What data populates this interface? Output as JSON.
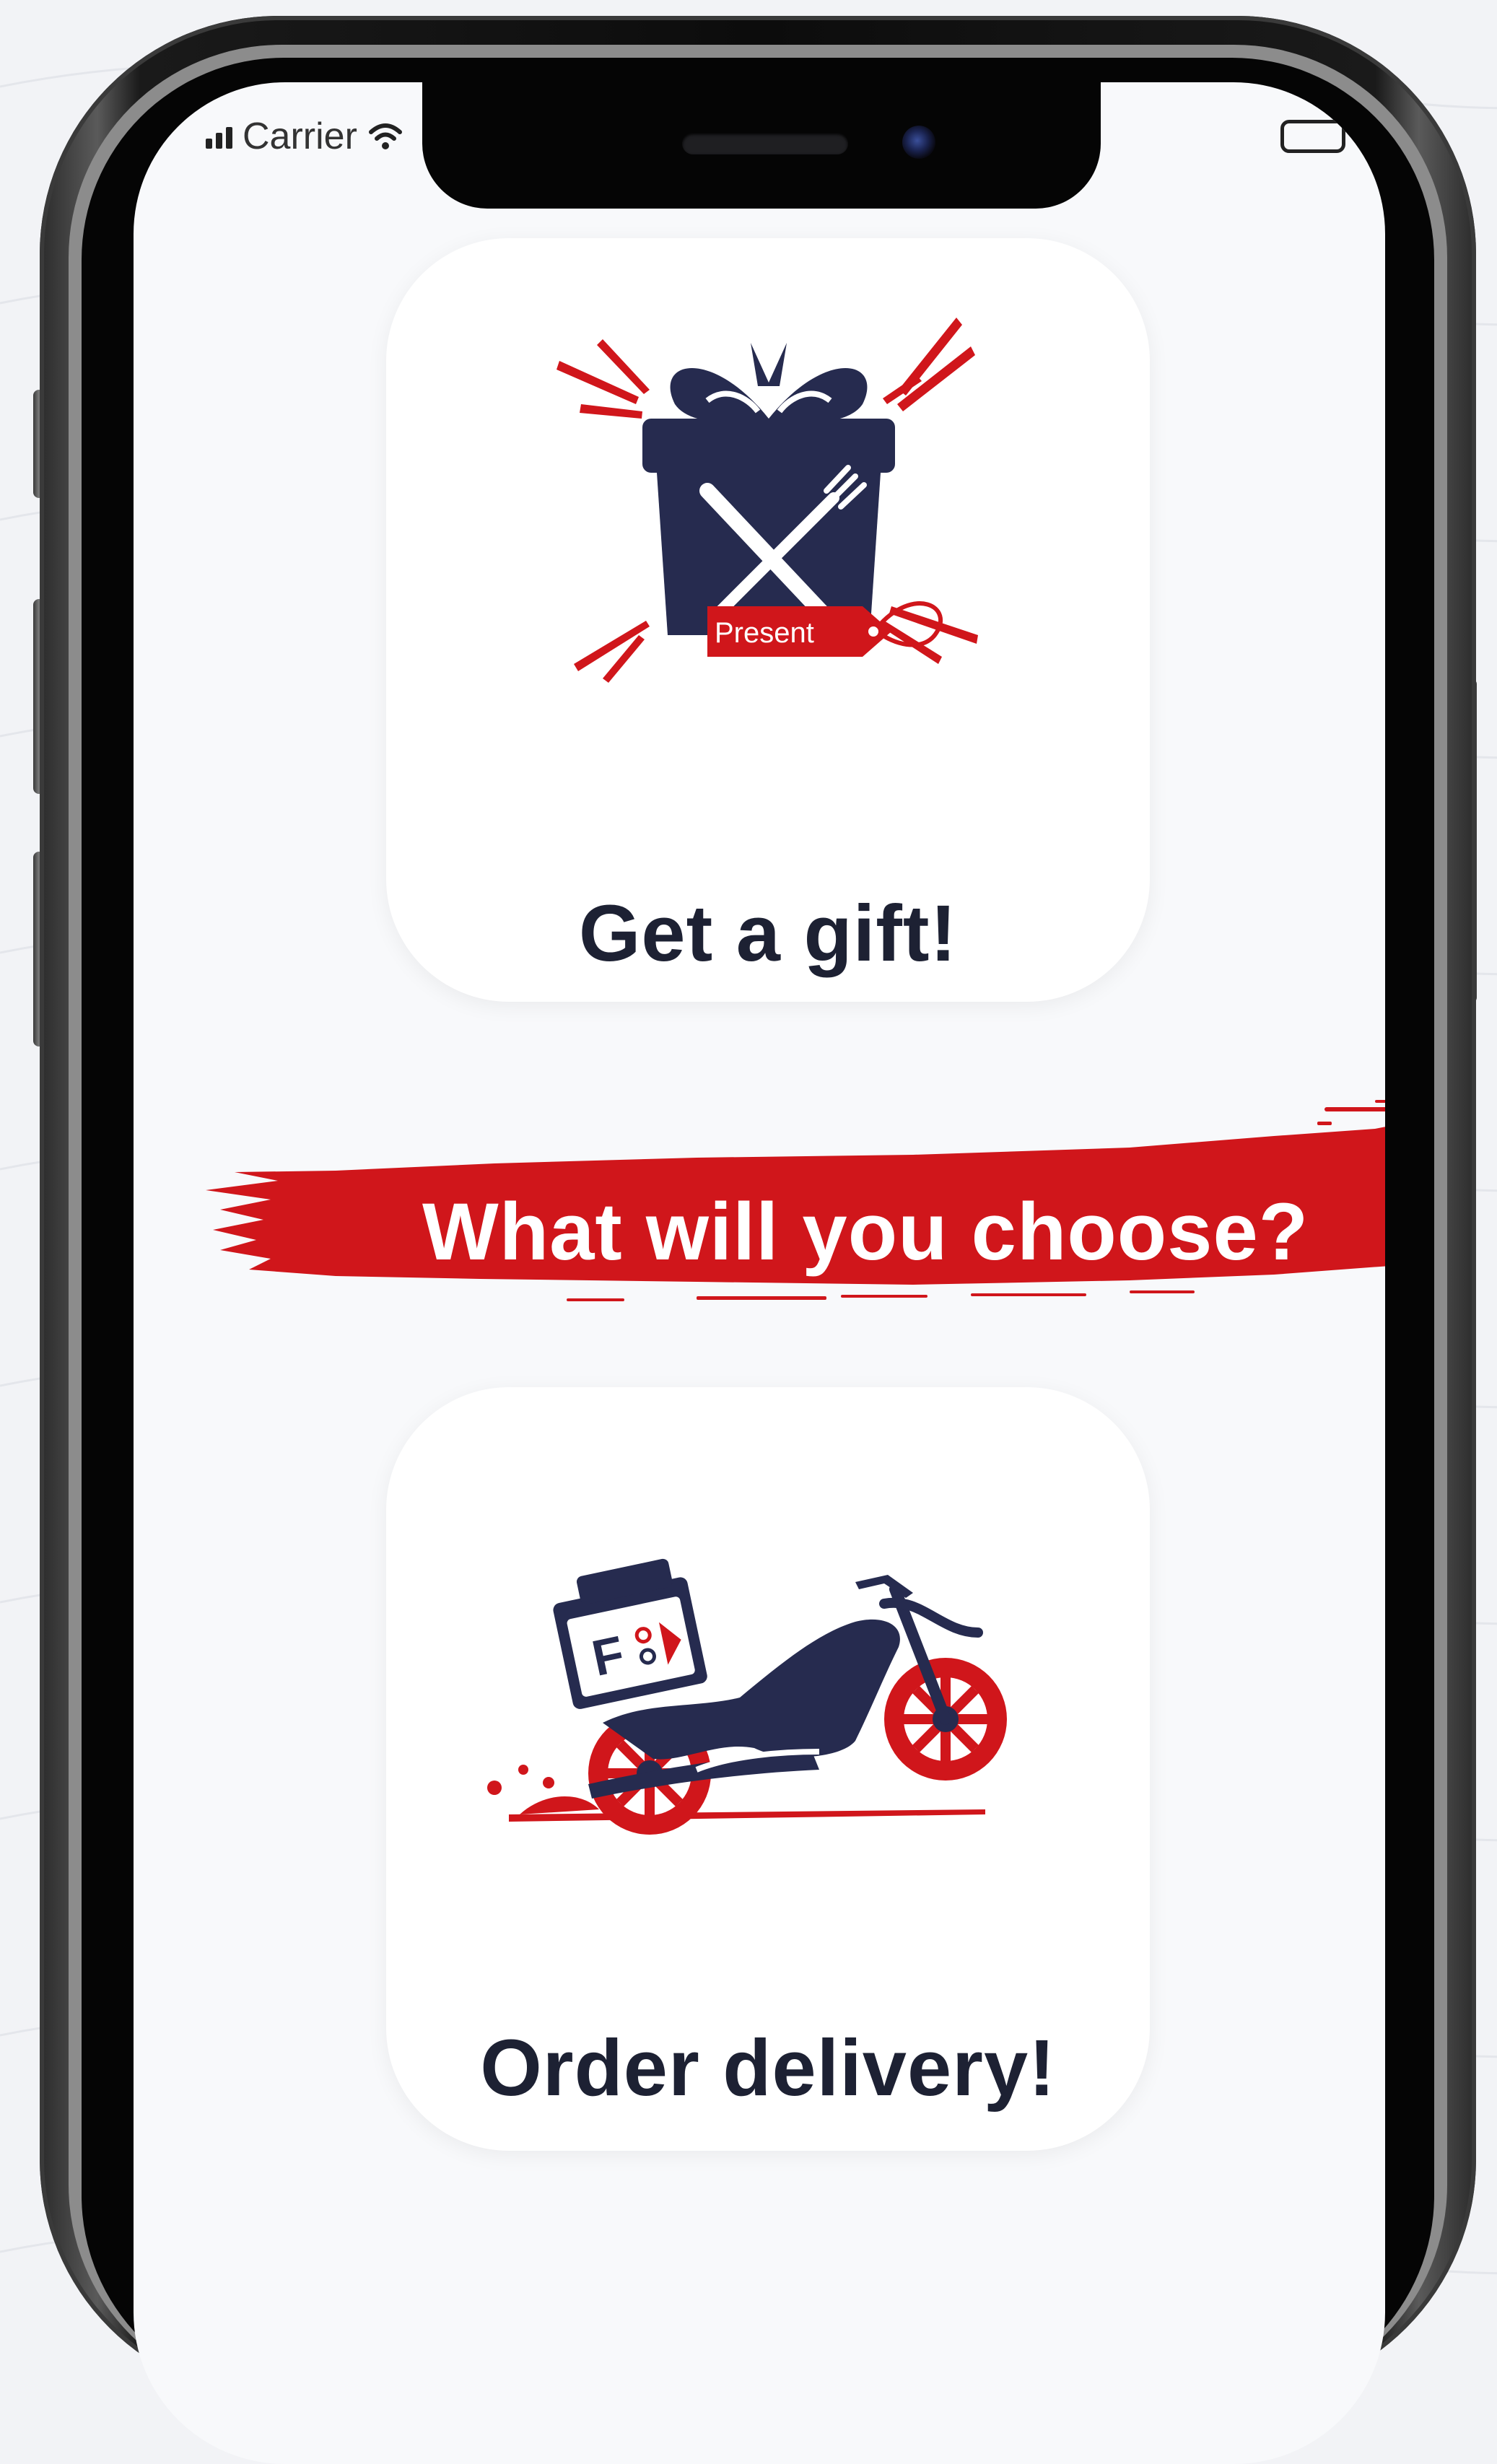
{
  "status_bar": {
    "carrier": "Carrier",
    "signal_icon": "signal-bars-icon",
    "wifi_icon": "wifi-icon",
    "battery_icon": "battery-icon"
  },
  "options": {
    "gift": {
      "label": "Get a gift!",
      "tag_text": "Present",
      "icon": "gift-box-icon"
    },
    "delivery": {
      "label": "Order delivery!",
      "box_text": "F",
      "icon": "delivery-motorcycle-icon"
    }
  },
  "prompt": {
    "text": "What will you choose?"
  },
  "colors": {
    "brand_red": "#d0161b",
    "navy": "#262b4f",
    "text_dark": "#1d2133",
    "screen_bg": "#f8f9fb",
    "card_bg": "#ffffff"
  }
}
